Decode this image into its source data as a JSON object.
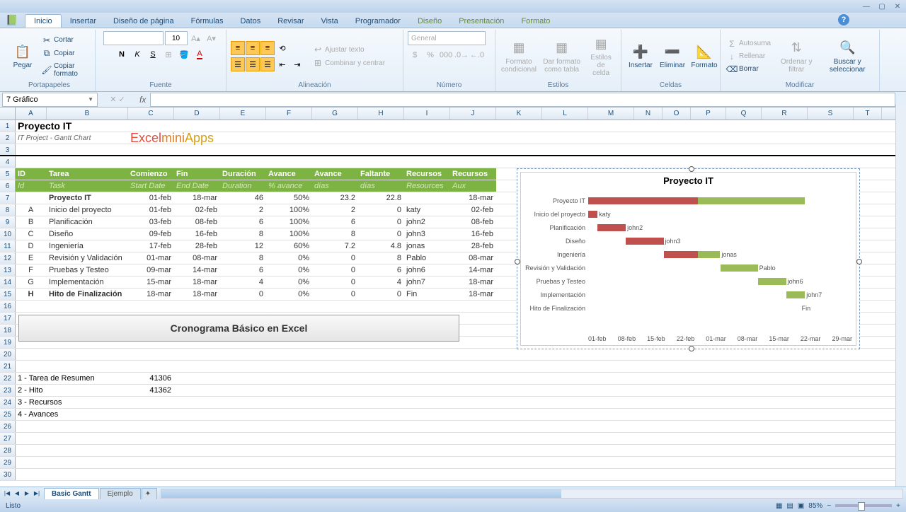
{
  "window": {
    "help": "?"
  },
  "tabs": [
    "Inicio",
    "Insertar",
    "Diseño de página",
    "Fórmulas",
    "Datos",
    "Revisar",
    "Vista",
    "Programador",
    "Diseño",
    "Presentación",
    "Formato"
  ],
  "ribbon": {
    "clipboard": {
      "label": "Portapapeles",
      "paste": "Pegar",
      "cut": "Cortar",
      "copy": "Copiar",
      "fmt": "Copiar formato"
    },
    "font": {
      "label": "Fuente",
      "size": "10"
    },
    "align": {
      "label": "Alineación",
      "wrap": "Ajustar texto",
      "merge": "Combinar y centrar"
    },
    "number": {
      "label": "Número",
      "format": "General"
    },
    "styles": {
      "label": "Estilos",
      "cond": "Formato condicional",
      "tbl": "Dar formato como tabla",
      "cell": "Estilos de celda"
    },
    "cells": {
      "label": "Celdas",
      "insert": "Insertar",
      "delete": "Eliminar",
      "format": "Formato"
    },
    "edit": {
      "label": "Modificar",
      "sum": "Autosuma",
      "fill": "Rellenar",
      "clear": "Borrar",
      "sort": "Ordenar y filtrar",
      "find": "Buscar y seleccionar"
    }
  },
  "namebox": "7 Gráfico",
  "sheet": {
    "title": "Proyecto IT",
    "subtitle": "IT Project - Gantt Chart",
    "brand1": "Excel",
    "brand2": "mini",
    "brand3": "Apps",
    "headers": [
      "ID",
      "Tarea",
      "Comienzo",
      "Fin",
      "Duración",
      "Avance",
      "Avance",
      "Faltante",
      "Recursos",
      "Recursos"
    ],
    "headers2": [
      "Id",
      "Task",
      "Start Date",
      "End Date",
      "Duration",
      "% avance",
      "días",
      "días",
      "Resources",
      "Aux"
    ],
    "rows": [
      {
        "id": "",
        "tarea": "Proyecto IT",
        "com": "01-feb",
        "fin": "18-mar",
        "dur": "46",
        "pav": "50%",
        "ad": "23.2",
        "fal": "22.8",
        "res": "",
        "aux": "18-mar",
        "bold": true
      },
      {
        "id": "A",
        "tarea": "Inicio del proyecto",
        "com": "01-feb",
        "fin": "02-feb",
        "dur": "2",
        "pav": "100%",
        "ad": "2",
        "fal": "0",
        "res": "katy",
        "aux": "02-feb"
      },
      {
        "id": "B",
        "tarea": "Planificación",
        "com": "03-feb",
        "fin": "08-feb",
        "dur": "6",
        "pav": "100%",
        "ad": "6",
        "fal": "0",
        "res": "john2",
        "aux": "08-feb"
      },
      {
        "id": "C",
        "tarea": "Diseño",
        "com": "09-feb",
        "fin": "16-feb",
        "dur": "8",
        "pav": "100%",
        "ad": "8",
        "fal": "0",
        "res": "john3",
        "aux": "16-feb"
      },
      {
        "id": "D",
        "tarea": "Ingeniería",
        "com": "17-feb",
        "fin": "28-feb",
        "dur": "12",
        "pav": "60%",
        "ad": "7.2",
        "fal": "4.8",
        "res": "jonas",
        "aux": "28-feb"
      },
      {
        "id": "E",
        "tarea": "Revisión y Validación",
        "com": "01-mar",
        "fin": "08-mar",
        "dur": "8",
        "pav": "0%",
        "ad": "0",
        "fal": "8",
        "res": "Pablo",
        "aux": "08-mar"
      },
      {
        "id": "F",
        "tarea": "Pruebas y Testeo",
        "com": "09-mar",
        "fin": "14-mar",
        "dur": "6",
        "pav": "0%",
        "ad": "0",
        "fal": "6",
        "res": "john6",
        "aux": "14-mar"
      },
      {
        "id": "G",
        "tarea": "Implementación",
        "com": "15-mar",
        "fin": "18-mar",
        "dur": "4",
        "pav": "0%",
        "ad": "0",
        "fal": "4",
        "res": "john7",
        "aux": "18-mar"
      },
      {
        "id": "H",
        "tarea": "Hito de Finalización",
        "com": "18-mar",
        "fin": "18-mar",
        "dur": "0",
        "pav": "0%",
        "ad": "0",
        "fal": "0",
        "res": "Fin",
        "aux": "18-mar",
        "bold": true
      }
    ],
    "banner": "Cronograma Básico en Excel",
    "notes": [
      {
        "r": "22",
        "t": "1 - Tarea de Resumen",
        "v": "41306"
      },
      {
        "r": "23",
        "t": "2 - Hito",
        "v": "41362"
      },
      {
        "r": "24",
        "t": "3 - Recursos",
        "v": ""
      },
      {
        "r": "25",
        "t": "4 - Avances",
        "v": ""
      }
    ]
  },
  "chart_data": {
    "type": "bar",
    "title": "Proyecto IT",
    "categories": [
      "Proyecto IT",
      "Inicio del proyecto",
      "Planificación",
      "Diseño",
      "Ingeniería",
      "Revisión y Validación",
      "Pruebas y Testeo",
      "Implementación",
      "Hito de Finalización"
    ],
    "series": [
      {
        "name": "offset_days",
        "values": [
          0,
          0,
          2,
          8,
          16,
          28,
          36,
          42,
          45
        ]
      },
      {
        "name": "done_days",
        "values": [
          23.2,
          2,
          6,
          8,
          7.2,
          0,
          0,
          0,
          0
        ]
      },
      {
        "name": "remaining_days",
        "values": [
          22.8,
          0,
          0,
          0,
          4.8,
          8,
          6,
          4,
          0
        ]
      }
    ],
    "resources": [
      "",
      "katy",
      "john2",
      "john3",
      "jonas",
      "Pablo",
      "john6",
      "john7",
      "Fin"
    ],
    "xlabel": "",
    "ylabel": "",
    "x_ticks": [
      "01-feb",
      "08-feb",
      "15-feb",
      "22-feb",
      "01-mar",
      "08-mar",
      "15-mar",
      "22-mar",
      "29-mar"
    ],
    "xlim": [
      0,
      56
    ]
  },
  "tabs_sheets": [
    "Basic Gantt",
    "Ejemplo"
  ],
  "status": {
    "ready": "Listo",
    "zoom": "85%"
  }
}
